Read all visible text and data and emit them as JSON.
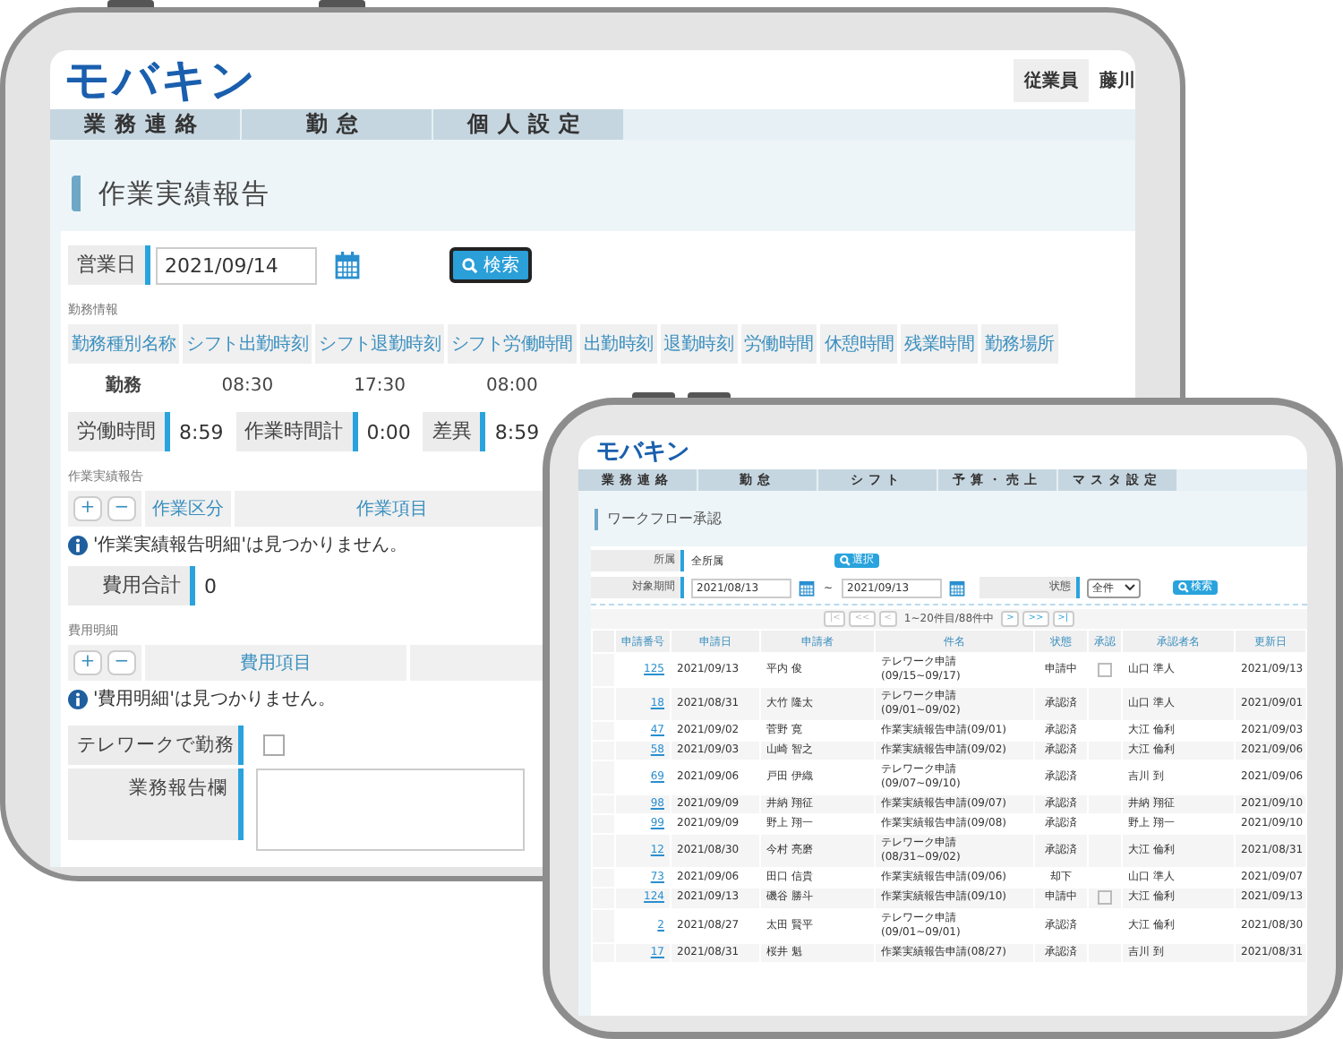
{
  "main_screen": {
    "logo": "モバキン",
    "user_role": "従業員",
    "user_name": "藤川",
    "nav": [
      "業務連絡",
      "勤怠",
      "個人設定"
    ],
    "page_title": "作業実績報告",
    "business_date": {
      "label": "営業日",
      "value": "2021/09/14"
    },
    "search_button": "検索",
    "work_info": {
      "title": "勤務情報",
      "columns": [
        "勤務種別名称",
        "シフト出勤時刻",
        "シフト退勤時刻",
        "シフト労働時間",
        "出勤時刻",
        "退勤時刻",
        "労働時間",
        "休憩時間",
        "残業時間",
        "勤務場所"
      ],
      "values": [
        "勤務",
        "08:30",
        "17:30",
        "08:00"
      ]
    },
    "summary": [
      {
        "label": "労働時間",
        "value": "8:59"
      },
      {
        "label": "作業時間計",
        "value": "0:00"
      },
      {
        "label": "差異",
        "value": "8:59"
      }
    ],
    "work_report": {
      "title": "作業実績報告",
      "add_button": "+",
      "remove_button": "−",
      "columns": [
        "作業区分",
        "作業項目"
      ],
      "message": "'作業実績報告明細'は見つかりません。"
    },
    "cost_total": {
      "label": "費用合計",
      "value": "0"
    },
    "cost_details": {
      "title": "費用明細",
      "add_button": "+",
      "remove_button": "−",
      "columns": [
        "費用項目"
      ],
      "message": "'費用明細'は見つかりません。"
    },
    "telework": {
      "label": "テレワークで勤務",
      "checked": false
    },
    "report_field": {
      "label": "業務報告欄"
    }
  },
  "front_screen": {
    "logo": "モバキン",
    "nav": [
      "業務連絡",
      "勤怠",
      "シフト",
      "予算・売上",
      "マスタ設定"
    ],
    "page_title": "ワークフロー承認",
    "department": {
      "label": "所属",
      "value": "全所属",
      "button": "選択"
    },
    "period": {
      "label": "対象期間",
      "from": "2021/08/13",
      "separator": "~",
      "to": "2021/09/13"
    },
    "status": {
      "label": "状態",
      "value": "全件"
    },
    "search_button": "検索",
    "pager": {
      "first": {
        "label": "|<",
        "disabled": true
      },
      "prev_page": {
        "label": "<<",
        "disabled": true
      },
      "prev": {
        "label": "<",
        "disabled": true
      },
      "info": "1~20件目/88件中",
      "next": {
        "label": ">",
        "disabled": false
      },
      "next_page": {
        "label": ">>",
        "disabled": false
      },
      "last": {
        "label": ">|",
        "disabled": false
      }
    },
    "columns": [
      "申請番号",
      "申請日",
      "申請者",
      "件名",
      "状態",
      "承認",
      "承認者名",
      "更新日"
    ],
    "rows": [
      {
        "number": "125",
        "date": "2021/09/13",
        "applicant": "平内 俊",
        "subject": "テレワーク申請(09/15~09/17)",
        "status": "申請中",
        "approve_checked": false,
        "approver": "山口 準人",
        "updated": "2021/09/13"
      },
      {
        "number": "18",
        "date": "2021/08/31",
        "applicant": "大竹 隆太",
        "subject": "テレワーク申請(09/01~09/02)",
        "status": "承認済",
        "approver": "山口 準人",
        "updated": "2021/09/01"
      },
      {
        "number": "47",
        "date": "2021/09/02",
        "applicant": "菅野 寛",
        "subject": "作業実績報告申請(09/01)",
        "status": "承認済",
        "approver": "大江 倫利",
        "updated": "2021/09/03"
      },
      {
        "number": "58",
        "date": "2021/09/03",
        "applicant": "山崎 智之",
        "subject": "作業実績報告申請(09/02)",
        "status": "承認済",
        "approver": "大江 倫利",
        "updated": "2021/09/06"
      },
      {
        "number": "69",
        "date": "2021/09/06",
        "applicant": "戸田 伊織",
        "subject": "テレワーク申請(09/07~09/10)",
        "status": "承認済",
        "approver": "吉川 到",
        "updated": "2021/09/06"
      },
      {
        "number": "98",
        "date": "2021/09/09",
        "applicant": "井納 翔征",
        "subject": "作業実績報告申請(09/07)",
        "status": "承認済",
        "approver": "井納 翔征",
        "updated": "2021/09/10"
      },
      {
        "number": "99",
        "date": "2021/09/09",
        "applicant": "野上 翔一",
        "subject": "作業実績報告申請(09/08)",
        "status": "承認済",
        "approver": "野上 翔一",
        "updated": "2021/09/10"
      },
      {
        "number": "12",
        "date": "2021/08/30",
        "applicant": "今村 亮磨",
        "subject": "テレワーク申請(08/31~09/02)",
        "status": "承認済",
        "approver": "大江 倫利",
        "updated": "2021/08/31"
      },
      {
        "number": "73",
        "date": "2021/09/06",
        "applicant": "田口 信貴",
        "subject": "作業実績報告申請(09/06)",
        "status": "却下",
        "approver": "山口 準人",
        "updated": "2021/09/07"
      },
      {
        "number": "124",
        "date": "2021/09/13",
        "applicant": "磯谷 勝斗",
        "subject": "作業実績報告申請(09/10)",
        "status": "申請中",
        "approve_checked": false,
        "approver": "大江 倫利",
        "updated": "2021/09/13"
      },
      {
        "number": "2",
        "date": "2021/08/27",
        "applicant": "太田 賢平",
        "subject": "テレワーク申請(09/01~09/01)",
        "status": "承認済",
        "approver": "大江 倫利",
        "updated": "2021/08/30"
      },
      {
        "number": "17",
        "date": "2021/08/31",
        "applicant": "桜井 魁",
        "subject": "作業実績報告申請(08/27)",
        "status": "承認済",
        "approver": "吉川 到",
        "updated": "2021/08/31"
      }
    ]
  }
}
